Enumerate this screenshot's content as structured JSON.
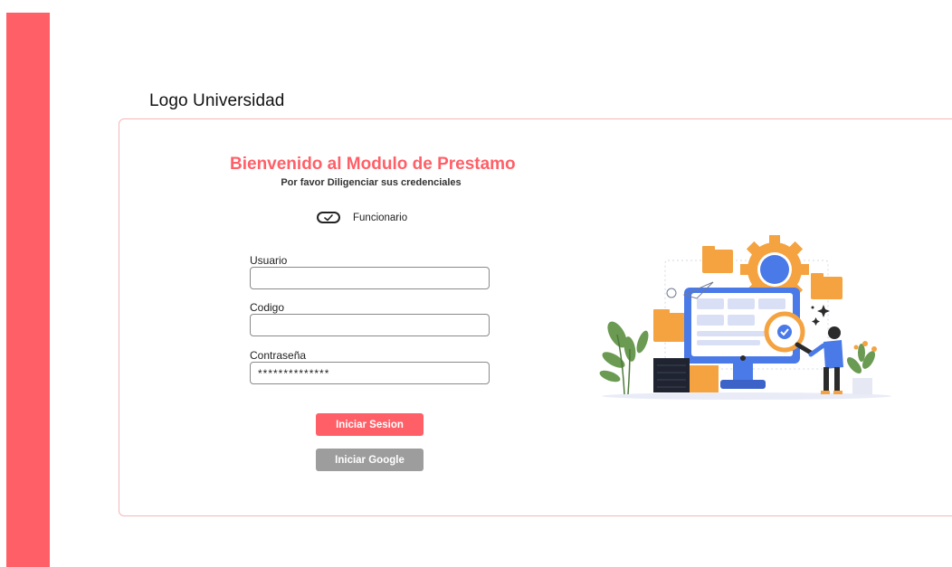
{
  "header": {
    "logo_text": "Logo Universidad"
  },
  "login": {
    "title": "Bienvenido al Modulo de Prestamo",
    "subtitle": "Por favor Diligenciar sus credenciales",
    "toggle_label": "Funcionario",
    "fields": {
      "usuario": {
        "label": "Usuario",
        "value": ""
      },
      "codigo": {
        "label": "Codigo",
        "value": ""
      },
      "contrasena": {
        "label": "Contraseña",
        "value": "**************"
      }
    },
    "buttons": {
      "login": "Iniciar Sesion",
      "google": "Iniciar Google"
    }
  },
  "colors": {
    "accent": "#ff5f67",
    "google_button": "#9d9d9d",
    "card_border": "#f6b6ba"
  },
  "icons": {
    "toggle": "check-toggle-icon",
    "illustration": "computer-settings-illustration"
  }
}
